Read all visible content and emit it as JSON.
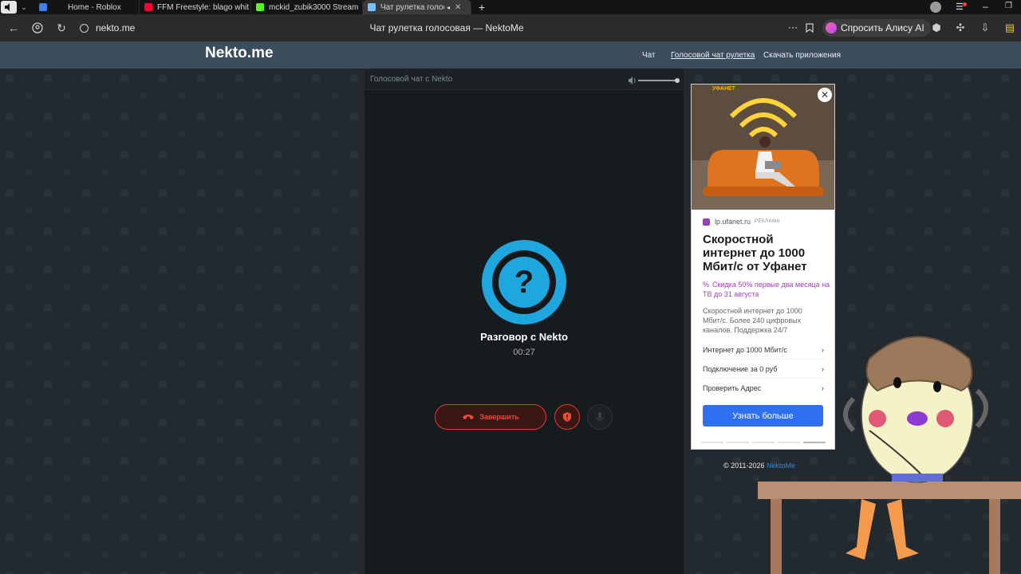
{
  "browser": {
    "tabs": [
      {
        "label": "Home - Roblox",
        "icon_color": "#3d7ff0"
      },
      {
        "label": "FFM Freestyle: blago whit",
        "icon_color": "#ff0033"
      },
      {
        "label": "mckid_zubik3000 Stream",
        "icon_color": "#53fc18"
      },
      {
        "label": "Чат рулетка голосов",
        "icon_color": "#7cc1ff",
        "active": true
      }
    ],
    "new_tab_label": "+",
    "url": "nekto.me",
    "page_title": "Чат рулетка голосовая — NektoMe",
    "alisa_label": "Спросить Алису AI",
    "icons": [
      "back-icon",
      "yandex-icon",
      "reload-icon",
      "site-info-icon",
      "more-icon",
      "bookmark-icon",
      "translate-icon",
      "extensions-icon",
      "downloads-icon",
      "notes-icon"
    ]
  },
  "site": {
    "logo": "Nekto.me",
    "nav": {
      "chat": "Чат",
      "voice_roulette": "Голосовой чат рулетка",
      "download_apps": "Скачать приложения"
    }
  },
  "chat": {
    "header_title": "Голосовой чат с Nekto",
    "avatar_symbol": "?",
    "partner_name": "Разговор с Nekto",
    "timer": "00:27",
    "end_label": "Завершить",
    "accent_color": "#1ea6df",
    "danger_color": "#e23b2d"
  },
  "ad": {
    "source": "lp.ufanet.ru",
    "tag": "РЕКЛАМА",
    "title": "Скоростной интернет до 1000 Мбит/с от Уфанет",
    "promo": "Скидка 50% первые два месяца на ТВ до 31 августа",
    "description": "Скоростной интернет до 1000 Мбит/с. Более 240 цифровых каналов. Поддержка 24/7",
    "links": [
      "Интернет до 1000 Мбит/с",
      "Подключение за 0 руб",
      "Проверить Адрес"
    ],
    "cta": "Узнать больше",
    "image_brand": "УФАНЕТ",
    "slides_total": 5,
    "slide_active": 5
  },
  "footer": {
    "copyright": "© 2011-2026",
    "brand_link": "NektoMe"
  }
}
